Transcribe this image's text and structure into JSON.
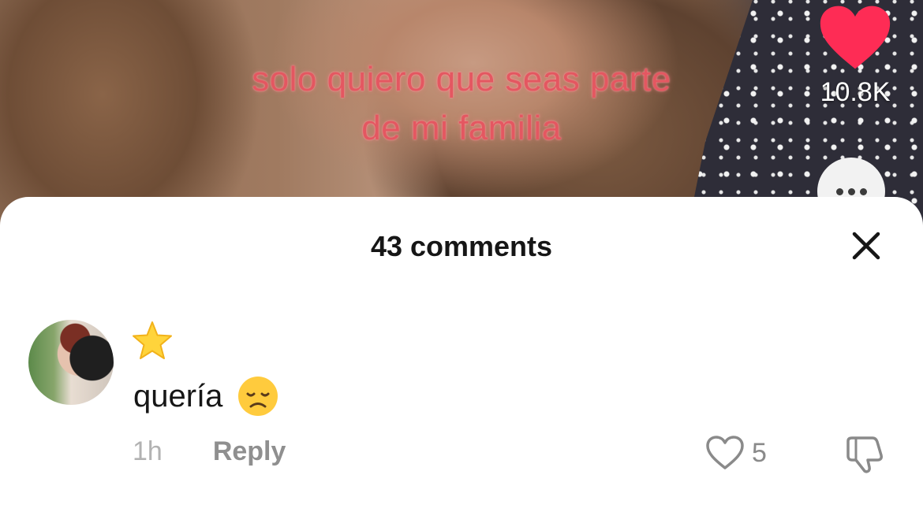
{
  "video": {
    "caption_line1": "solo quiero que seas parte",
    "caption_line2": "de mi familia",
    "like_count": "10.8K",
    "like_color": "#fe2c55"
  },
  "comments_sheet": {
    "title": "43 comments",
    "close_icon": "close-icon",
    "comment": {
      "username_emoji": "⭐",
      "text": "quería",
      "text_emoji": "😞",
      "time": "1h",
      "reply_label": "Reply",
      "like_count": "5"
    }
  }
}
